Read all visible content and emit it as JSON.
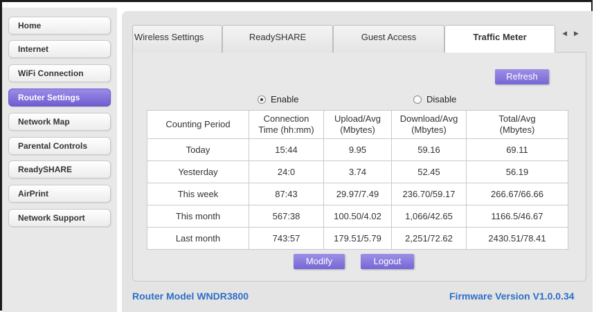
{
  "sidebar": {
    "items": [
      {
        "label": "Home"
      },
      {
        "label": "Internet"
      },
      {
        "label": "WiFi Connection"
      },
      {
        "label": "Router Settings"
      },
      {
        "label": "Network Map"
      },
      {
        "label": "Parental Controls"
      },
      {
        "label": "ReadySHARE"
      },
      {
        "label": "AirPrint"
      },
      {
        "label": "Network Support"
      }
    ],
    "active_item": "Router Settings"
  },
  "tabs": [
    {
      "label": "Wireless Settings"
    },
    {
      "label": "ReadySHARE"
    },
    {
      "label": "Guest Access"
    },
    {
      "label": "Traffic Meter"
    }
  ],
  "active_tab": "Traffic Meter",
  "tab_scroll": {
    "prev_icon": "◀",
    "next_icon": "▶"
  },
  "buttons": {
    "refresh": "Refresh",
    "modify": "Modify",
    "logout": "Logout"
  },
  "meter_toggle": {
    "enable_label": "Enable",
    "disable_label": "Disable",
    "selected": "Enable"
  },
  "table": {
    "headers": [
      "Counting Period",
      "Connection\nTime  (hh:mm)",
      "Upload/Avg\n(Mbytes)",
      "Download/Avg\n(Mbytes)",
      "Total/Avg\n(Mbytes)"
    ],
    "rows": [
      [
        "Today",
        "15:44",
        "9.95",
        "59.16",
        "69.11"
      ],
      [
        "Yesterday",
        "24:0",
        "3.74",
        "52.45",
        "56.19"
      ],
      [
        "This week",
        "87:43",
        "29.97/7.49",
        "236.70/59.17",
        "266.67/66.66"
      ],
      [
        "This month",
        "567:38",
        "100.50/4.02",
        "1,066/42.65",
        "1166.5/46.67"
      ],
      [
        "Last month",
        "743:57",
        "179.51/5.79",
        "2,251/72.62",
        "2430.51/78.41"
      ]
    ]
  },
  "footer": {
    "router_model": "Router Model WNDR3800",
    "firmware": "Firmware Version V1.0.0.34"
  },
  "colors": {
    "accent": "#7567d4",
    "active_nav": "#7a68d8",
    "footer_text": "#2c6ec9"
  }
}
